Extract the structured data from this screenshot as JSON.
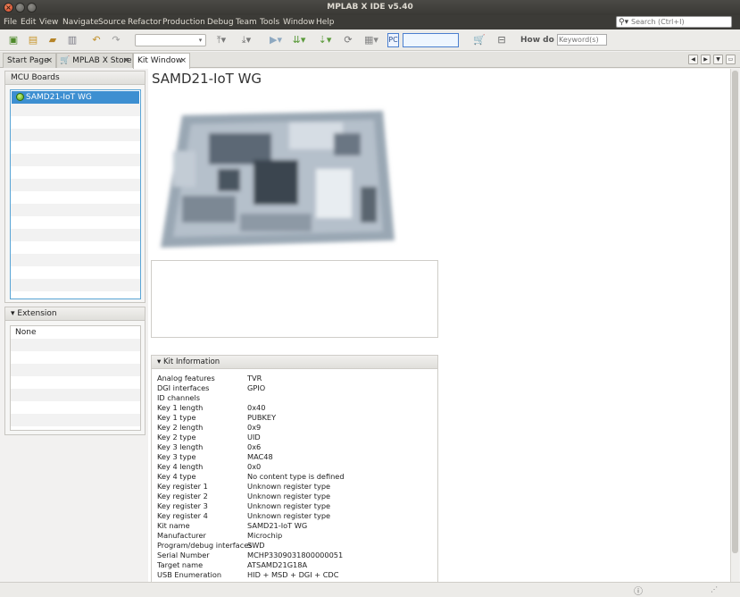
{
  "window": {
    "title": "MPLAB X IDE v5.40"
  },
  "menu": {
    "items": [
      "File",
      "Edit",
      "View",
      "Navigate",
      "Source",
      "Refactor",
      "Production",
      "Debug",
      "Team",
      "Tools",
      "Window",
      "Help"
    ],
    "search_placeholder": "Search (Ctrl+I)"
  },
  "toolbar": {
    "pc_label": "PC",
    "howdo_label": "How do I?",
    "keyword_placeholder": "Keyword(s)"
  },
  "tabs": [
    {
      "label": "Start Page",
      "active": false
    },
    {
      "label": "MPLAB X Store",
      "active": false
    },
    {
      "label": "Kit Window",
      "active": true
    }
  ],
  "mcu_boards": {
    "header": "MCU Boards",
    "items": [
      {
        "label": "SAMD21-IoT WG",
        "selected": true
      }
    ]
  },
  "extension": {
    "header": "Extension",
    "items": [
      "None"
    ]
  },
  "kit": {
    "title": "SAMD21-IoT WG",
    "info_header": "Kit Information",
    "info": [
      {
        "key": "Analog features",
        "value": "TVR"
      },
      {
        "key": "DGI interfaces",
        "value": "GPIO"
      },
      {
        "key": "ID channels",
        "value": ""
      },
      {
        "key": "Key 1 length",
        "value": "0x40"
      },
      {
        "key": "Key 1 type",
        "value": "PUBKEY"
      },
      {
        "key": "Key 2 length",
        "value": "0x9"
      },
      {
        "key": "Key 2 type",
        "value": "UID"
      },
      {
        "key": "Key 3 length",
        "value": "0x6"
      },
      {
        "key": "Key 3 type",
        "value": "MAC48"
      },
      {
        "key": "Key 4 length",
        "value": "0x0"
      },
      {
        "key": "Key 4 type",
        "value": "No content type is defined"
      },
      {
        "key": "Key register 1",
        "value": "Unknown register type"
      },
      {
        "key": "Key register 2",
        "value": "Unknown register type"
      },
      {
        "key": "Key register 3",
        "value": "Unknown register type"
      },
      {
        "key": "Key register 4",
        "value": "Unknown register type"
      },
      {
        "key": "Kit name",
        "value": "SAMD21-IoT WG"
      },
      {
        "key": "Manufacturer",
        "value": "Microchip"
      },
      {
        "key": "Program/debug interfaces",
        "value": "SWD"
      },
      {
        "key": "Serial Number",
        "value": "MCHP3309031800000051"
      },
      {
        "key": "Target name",
        "value": "ATSAMD21G18A"
      },
      {
        "key": "USB Enumeration",
        "value": "HID + MSD + DGI + CDC"
      }
    ]
  },
  "icons": {
    "toolbar": [
      "new-project-icon",
      "new-file-icon",
      "open-project-icon",
      "close-project-icon",
      "undo-icon",
      "redo-icon",
      "set-config-icon",
      "build-icon",
      "clean-build-icon",
      "run-icon",
      "debug-icon",
      "program-icon",
      "refresh-icon",
      "read-device-icon",
      "store-cart-icon",
      "kit-icon"
    ]
  }
}
